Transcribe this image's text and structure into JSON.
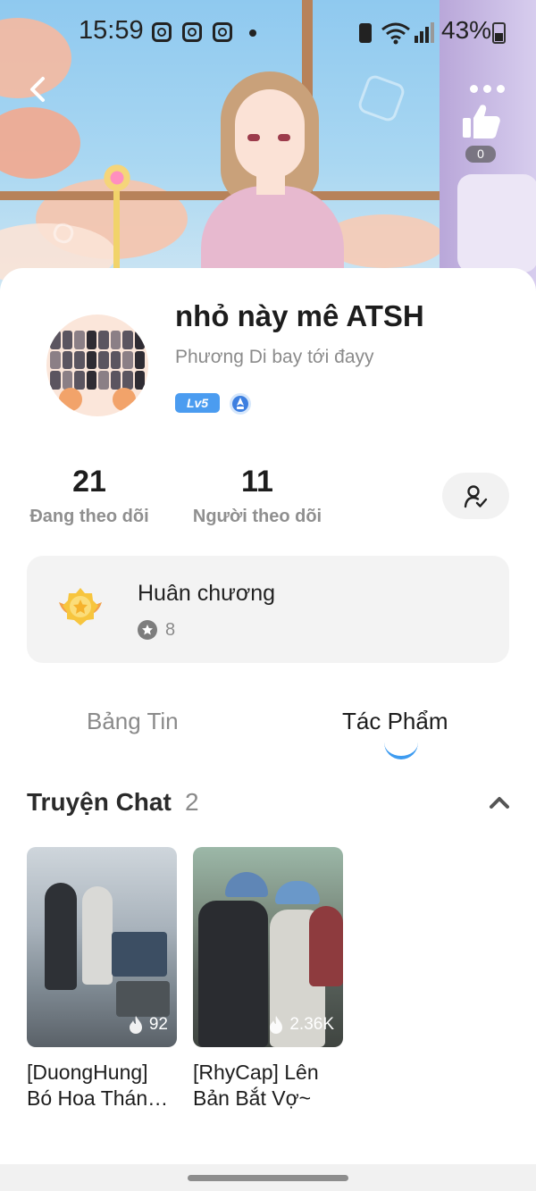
{
  "status_bar": {
    "time": "15:59",
    "battery_percent": "43%"
  },
  "banner": {
    "like_count": "0"
  },
  "profile": {
    "name": "nhỏ này mê ATSH",
    "bio": "Phương Di bay tới đayy",
    "level_badge": "Lv5"
  },
  "stats": {
    "following_count": "21",
    "following_label": "Đang theo dõi",
    "followers_count": "11",
    "followers_label": "Người theo dõi"
  },
  "medal": {
    "title": "Huân chương",
    "count": "8"
  },
  "tabs": [
    {
      "label": "Bảng Tin",
      "active": false
    },
    {
      "label": "Tác Phẩm",
      "active": true
    }
  ],
  "section": {
    "title": "Truyện Chat",
    "count": "2"
  },
  "stories": [
    {
      "title": "[DuongHung] Bó Hoa Thán…",
      "views": "92"
    },
    {
      "title": "[RhyCap] Lên Bản Bắt Vợ~",
      "views": "2.36K"
    }
  ],
  "colors": {
    "accent": "#3d9bf0",
    "level_badge": "#4b9cf0"
  }
}
